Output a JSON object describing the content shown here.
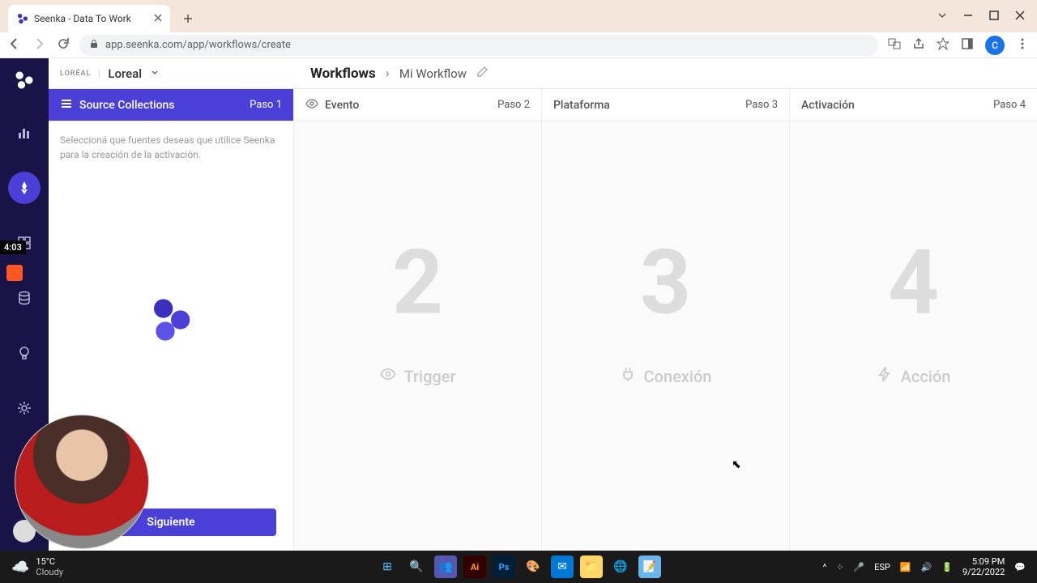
{
  "browser": {
    "tab_title": "Seenka - Data To Work",
    "url": "app.seenka.com/app/workflows/create",
    "avatar_letter": "C"
  },
  "header": {
    "brand_logo": "LORÉAL",
    "brand_name": "Loreal",
    "breadcrumb_root": "Workflows",
    "breadcrumb_current": "Mi Workflow"
  },
  "columns": {
    "c1": {
      "title": "Source Collections",
      "step": "Paso 1",
      "desc": "Seleccioná que fuentes deseas que utilice Seenka para la creación de la activación.",
      "button": "Siguiente"
    },
    "c2": {
      "title": "Evento",
      "step": "Paso 2",
      "num": "2",
      "label": "Trigger"
    },
    "c3": {
      "title": "Plataforma",
      "step": "Paso 3",
      "num": "3",
      "label": "Conexión"
    },
    "c4": {
      "title": "Activación",
      "step": "Paso 4",
      "num": "4",
      "label": "Acción"
    }
  },
  "overlay": {
    "time": "4:03"
  },
  "taskbar": {
    "temp": "15°C",
    "condition": "Cloudy",
    "lang": "ESP",
    "time": "5:09 PM",
    "date": "9/22/2022"
  }
}
